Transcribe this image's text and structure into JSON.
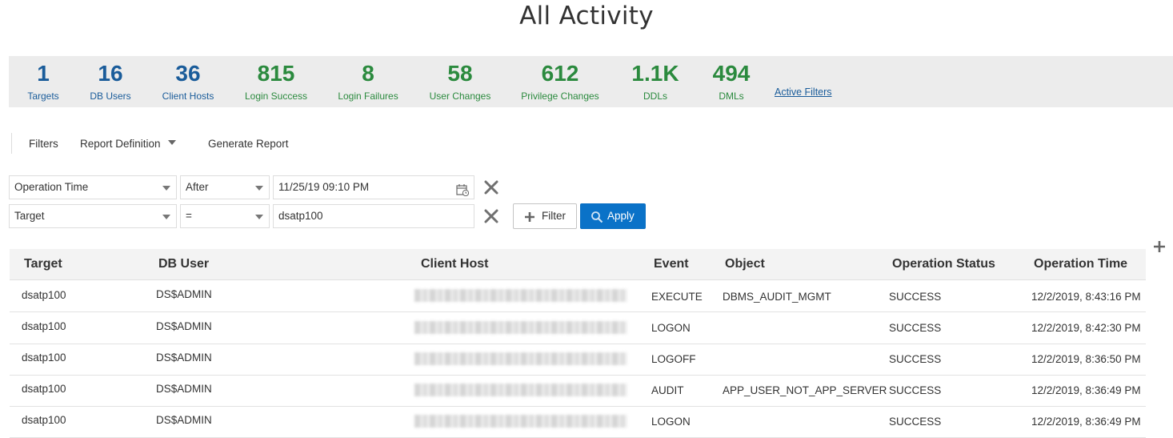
{
  "title": "All Activity",
  "summary": {
    "stats": [
      {
        "value": "1",
        "label": "Targets",
        "color": "#1a5c9a"
      },
      {
        "value": "16",
        "label": "DB Users",
        "color": "#1a5c9a"
      },
      {
        "value": "36",
        "label": "Client Hosts",
        "color": "#1a5c9a"
      },
      {
        "value": "815",
        "label": "Login Success",
        "color": "#2b8a3e"
      },
      {
        "value": "8",
        "label": "Login Failures",
        "color": "#2b8a3e"
      },
      {
        "value": "58",
        "label": "User Changes",
        "color": "#2b8a3e"
      },
      {
        "value": "612",
        "label": "Privilege Changes",
        "color": "#2b8a3e"
      },
      {
        "value": "1.1K",
        "label": "DDLs",
        "color": "#2b8a3e"
      },
      {
        "value": "494",
        "label": "DMLs",
        "color": "#2b8a3e"
      }
    ],
    "active_filters": "Active Filters"
  },
  "toolbar": {
    "filters": "Filters",
    "report_definition": "Report Definition",
    "generate_report": "Generate Report"
  },
  "filters": [
    {
      "field": "Operation Time",
      "operator": "After",
      "value": "11/25/19 09:10 PM"
    },
    {
      "field": "Target",
      "operator": "=",
      "value": "dsatp100"
    }
  ],
  "buttons": {
    "filter": "Filter",
    "apply": "Apply"
  },
  "table": {
    "columns": [
      "Target",
      "DB User",
      "Client Host",
      "Event",
      "Object",
      "Operation Status",
      "Operation Time"
    ],
    "rows": [
      {
        "target": "dsatp100",
        "db_user": "DS$ADMIN",
        "client_host": "",
        "event": "EXECUTE",
        "object": "DBMS_AUDIT_MGMT",
        "status": "SUCCESS",
        "time": "12/2/2019, 8:43:16 PM"
      },
      {
        "target": "dsatp100",
        "db_user": "DS$ADMIN",
        "client_host": "",
        "event": "LOGON",
        "object": "",
        "status": "SUCCESS",
        "time": "12/2/2019, 8:42:30 PM"
      },
      {
        "target": "dsatp100",
        "db_user": "DS$ADMIN",
        "client_host": "",
        "event": "LOGOFF",
        "object": "",
        "status": "SUCCESS",
        "time": "12/2/2019, 8:36:50 PM"
      },
      {
        "target": "dsatp100",
        "db_user": "DS$ADMIN",
        "client_host": "",
        "event": "AUDIT",
        "object": "APP_USER_NOT_APP_SERVER",
        "status": "SUCCESS",
        "time": "12/2/2019, 8:36:49 PM"
      },
      {
        "target": "dsatp100",
        "db_user": "DS$ADMIN",
        "client_host": "",
        "event": "LOGON",
        "object": "",
        "status": "SUCCESS",
        "time": "12/2/2019, 8:36:49 PM"
      }
    ]
  }
}
